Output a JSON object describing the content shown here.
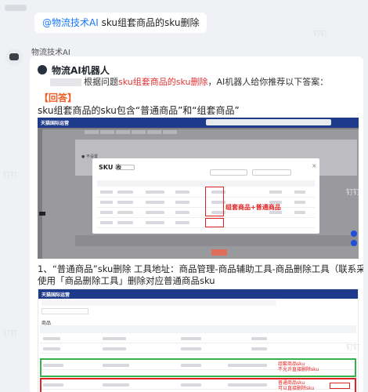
{
  "question": {
    "mention": "@物流技术AI",
    "text": " sku组套商品的sku删除"
  },
  "bot": {
    "sender_name": "物流技术AI",
    "card_title": "物流AI机器人",
    "intro_prefix": "根据问题",
    "intro_keyword": "sku组套商品的sku删除",
    "intro_suffix": "，AI机器人给你推荐以下答案：",
    "answer_tag": "【回答】",
    "answer_line1": "sku组套商品的sku包含“普通商品”和“组套商品”",
    "answer_line2a": "1、“普通商品”sku删除 工具地址：商品管理-商品辅助工具-商品删除工具（联系采购小二操作）",
    "answer_line2b": "使用「商品删除工具」删除对应普通商品sku"
  },
  "screenshot1": {
    "app_name": "天猫国际运营",
    "modal_title": "SKU 表",
    "radio_label": "● 不设置",
    "annotation": "组套商品+普通商品"
  },
  "screenshot2": {
    "app_name": "天猫国际运营",
    "section_label": "商品",
    "note_green_1": "组套商品sku",
    "note_green_2": "不允许直接删除sku",
    "note_red_1": "普通商品sku",
    "note_red_2": "可以直接删除sku"
  },
  "watermark": "钉钉",
  "colors": {
    "mention": "#1677ff",
    "highlight_red": "#e03333",
    "answer_tag": "#f05a24",
    "app_header": "#1e3a8a",
    "green_box": "#35b34a"
  }
}
